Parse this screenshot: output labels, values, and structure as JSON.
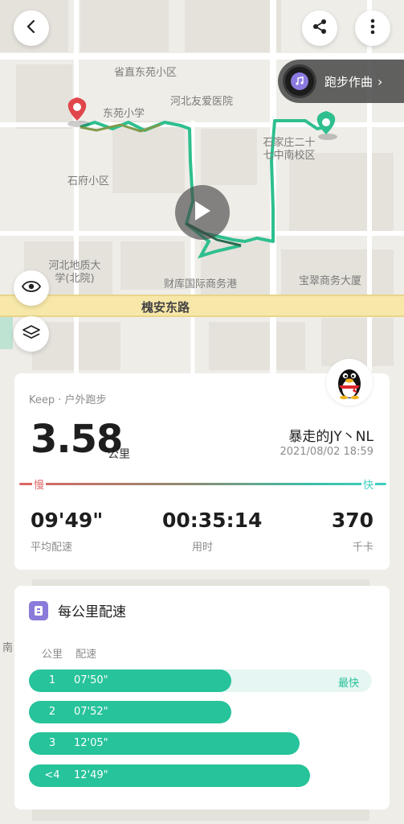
{
  "map": {
    "labels": {
      "dongyuan_xiaoqu": "省直东苑小区",
      "dongyuan_school": "东苑小学",
      "hebei_youai": "河北友爱医院",
      "shijiazhuang_school": "石家庄二十七中南校区",
      "shifu_xiaoqu": "石府小区",
      "hebei_geology": "河北地质大学(北院)",
      "caiku": "财库国际商务港",
      "baocui": "宝翠商务大厦",
      "road": "槐安东路",
      "edge": "南"
    },
    "music_label": "跑步作曲",
    "icons": [
      "back-icon",
      "share-icon",
      "more-icon",
      "eye-icon",
      "layers-icon",
      "play-icon",
      "music-disc-icon"
    ]
  },
  "activity": {
    "source": "Keep · 户外跑步",
    "distance": "3.58",
    "distance_unit": "公里",
    "username": "暴走的JY丶NL",
    "datetime": "2021/08/02 18:59",
    "slow_label": "慢",
    "fast_label": "快",
    "stats": [
      {
        "value": "09'49\"",
        "label": "平均配速"
      },
      {
        "value": "00:35:14",
        "label": "用时"
      },
      {
        "value": "370",
        "label": "千卡"
      }
    ]
  },
  "pace": {
    "title": "每公里配速",
    "col_km": "公里",
    "col_pace": "配速",
    "best_label": "最快",
    "rows": [
      {
        "km": "1",
        "pace": "07'50\"",
        "fill": 0.59,
        "best": true
      },
      {
        "km": "2",
        "pace": "07'52\"",
        "fill": 0.59,
        "best": false
      },
      {
        "km": "3",
        "pace": "12'05\"",
        "fill": 0.79,
        "best": false
      },
      {
        "km": "<4",
        "pace": "12'49\"",
        "fill": 0.82,
        "best": false
      }
    ]
  },
  "colors": {
    "route": "#2fbf8f",
    "accent": "#27c39a",
    "slow": "#e06666",
    "fast": "#3fd0c0",
    "start_pin": "#e0474c",
    "end_pin": "#2fbf8f"
  }
}
